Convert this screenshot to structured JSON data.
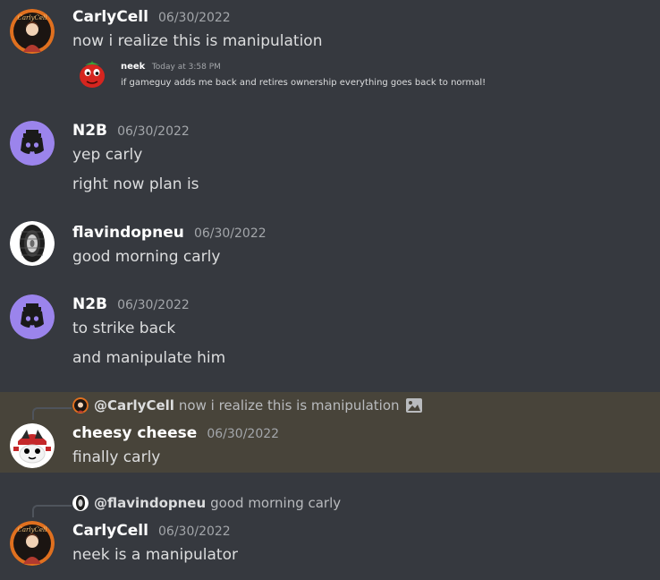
{
  "messages": [
    {
      "username": "CarlyCell",
      "timestamp": "06/30/2022",
      "lines": [
        "now i realize this is manipulation"
      ],
      "embed": {
        "username": "neek",
        "time": "Today at 3:58 PM",
        "text": "if gameguy adds me back and retires ownership everything goes back to normal!"
      },
      "avatar_logo_text": "CarlyCell"
    },
    {
      "username": "N2B",
      "timestamp": "06/30/2022",
      "lines": [
        "yep carly",
        "right now plan is"
      ]
    },
    {
      "username": "flavindopneu",
      "timestamp": "06/30/2022",
      "lines": [
        "good morning carly"
      ]
    },
    {
      "username": "N2B",
      "timestamp": "06/30/2022",
      "lines": [
        "to strike back",
        "and manipulate him"
      ]
    },
    {
      "reply": {
        "username": "@CarlyCell",
        "text": "now i realize this is manipulation",
        "icon": "image-icon"
      },
      "username": "cheesy cheese",
      "timestamp": "06/30/2022",
      "lines": [
        "finally carly"
      ]
    },
    {
      "reply": {
        "username": "@flavindopneu",
        "text": "good morning carly"
      },
      "username": "CarlyCell",
      "timestamp": "06/30/2022",
      "lines": [
        "neek is a manipulator"
      ]
    }
  ],
  "colors": {
    "background": "#36393f",
    "highlight": "#48443a",
    "username": "#ffffff",
    "text": "#dcddde",
    "timestamp": "#a3a6aa",
    "discord_purple": "#9b84ec"
  }
}
